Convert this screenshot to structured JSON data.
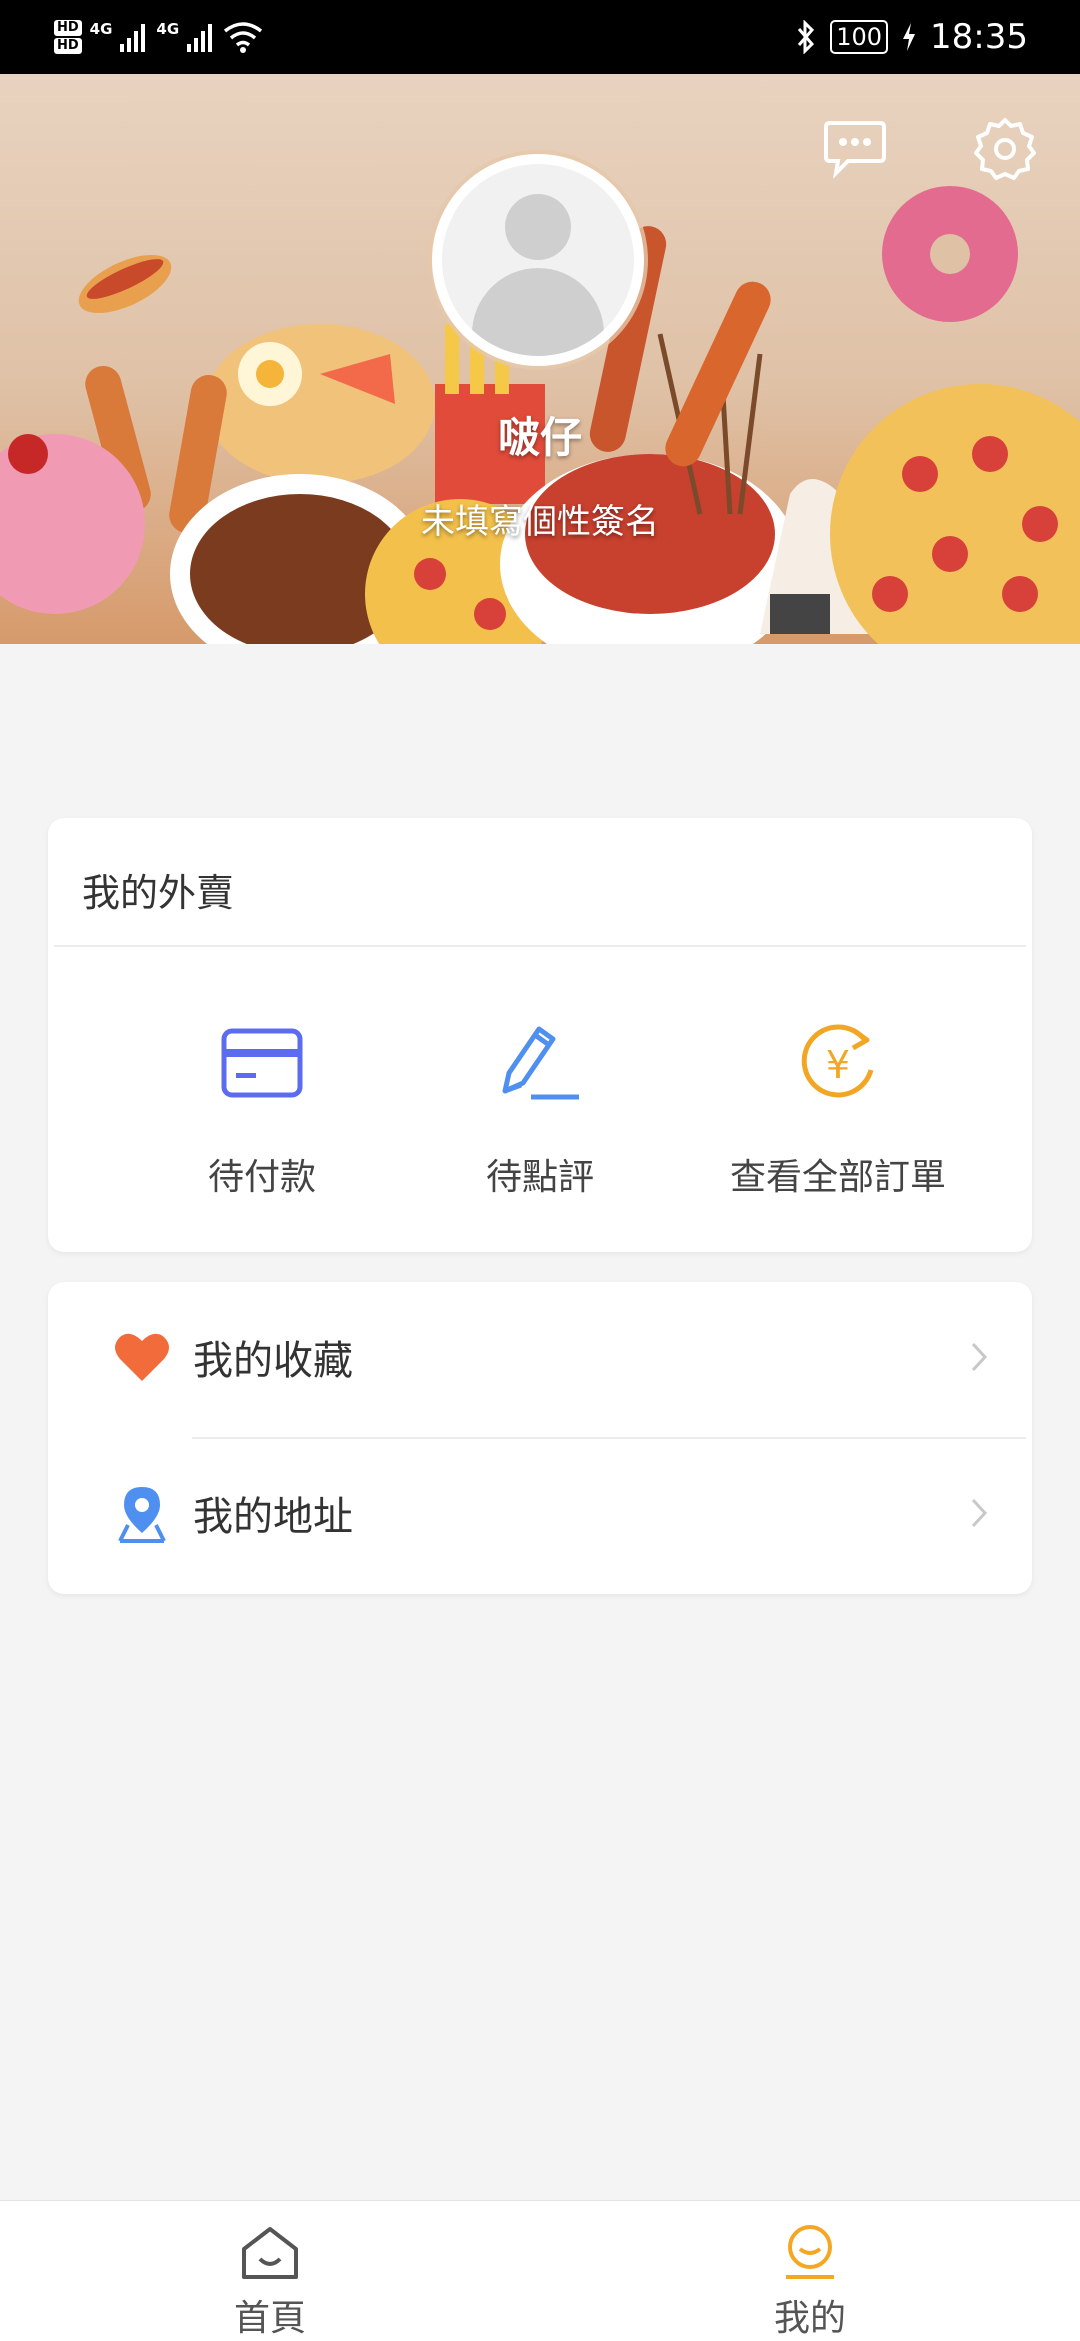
{
  "status_bar": {
    "sim1": "HD",
    "sim2": "HD",
    "network1": "4G",
    "network2": "4G",
    "battery": "100",
    "time": "18:35"
  },
  "profile": {
    "nickname": "啵仔",
    "signature": "未填寫個性簽名"
  },
  "header_icons": [
    "message-icon",
    "settings-icon"
  ],
  "orders": {
    "title": "我的外賣",
    "items": [
      {
        "label": "待付款",
        "icon": "card-icon"
      },
      {
        "label": "待點評",
        "icon": "pen-icon"
      },
      {
        "label": "查看全部訂單",
        "icon": "yen-refresh-icon"
      }
    ]
  },
  "menu": [
    {
      "label": "我的收藏",
      "icon": "heart-icon"
    },
    {
      "label": "我的地址",
      "icon": "location-icon"
    }
  ],
  "tabbar": [
    {
      "label": "首頁",
      "icon": "home-icon"
    },
    {
      "label": "我的",
      "icon": "profile-icon",
      "active": true
    }
  ],
  "colors": {
    "accent": "#f5a623",
    "heart": "#f26b3a",
    "blue_icon": "#4f8ff0",
    "orange_icon": "#f2a623"
  }
}
